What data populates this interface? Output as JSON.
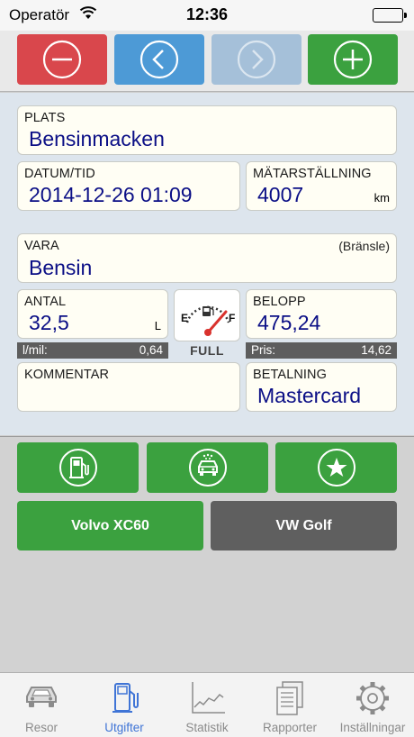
{
  "status": {
    "carrier": "Operatör",
    "time": "12:36"
  },
  "form": {
    "plats": {
      "label": "PLATS",
      "value": "Bensinmacken"
    },
    "datum": {
      "label": "DATUM/TID",
      "value": "2014-12-26 01:09"
    },
    "matare": {
      "label": "MÄTARSTÄLLNING",
      "value": "4007",
      "unit": "km"
    },
    "vara": {
      "label": "VARA",
      "value": "Bensin",
      "hint": "(Bränsle)"
    },
    "antal": {
      "label": "ANTAL",
      "value": "32,5",
      "unit": "L"
    },
    "belopp": {
      "label": "BELOPP",
      "value": "475,24"
    },
    "per_mil": {
      "label": "l/mil:",
      "value": "0,64"
    },
    "pris": {
      "label": "Pris:",
      "value": "14,62"
    },
    "gauge": {
      "empty": "E",
      "full": "F",
      "caption": "FULL"
    },
    "kommentar": {
      "label": "KOMMENTAR",
      "value": ""
    },
    "betalning": {
      "label": "BETALNING",
      "value": "Mastercard"
    }
  },
  "cars": [
    {
      "label": "Volvo XC60",
      "selected": true
    },
    {
      "label": "VW Golf",
      "selected": false
    }
  ],
  "tabs": [
    {
      "label": "Resor",
      "icon": "car-icon"
    },
    {
      "label": "Utgifter",
      "icon": "fuel-pump-icon",
      "active": true
    },
    {
      "label": "Statistik",
      "icon": "line-chart-icon"
    },
    {
      "label": "Rapporter",
      "icon": "documents-icon"
    },
    {
      "label": "Inställningar",
      "icon": "gear-icon"
    }
  ],
  "colors": {
    "red": "#d9474c",
    "blue": "#4d9ad6",
    "blue_disabled": "#a5c0d9",
    "green": "#3ba13f",
    "gray_button": "#5f5f5f",
    "value_text": "#0b0f86",
    "tab_active": "#3f74d6"
  }
}
